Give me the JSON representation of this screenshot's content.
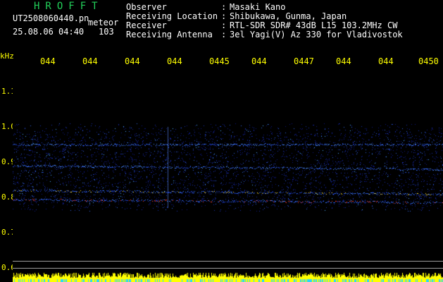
{
  "app": {
    "title": "HROFFT",
    "file_name": "UT2508060440.pn",
    "event_tag": "meteor",
    "date_time": "25.08.06 04:40",
    "count": "103"
  },
  "info": [
    {
      "label": "Observer",
      "value": "Masaki Kano"
    },
    {
      "label": "Receiving Location",
      "value": "Shibukawa, Gunma, Japan"
    },
    {
      "label": "Receiver",
      "value": "RTL-SDR SDR# 43dB L15 103.2MHz CW"
    },
    {
      "label": "Receiving Antenna",
      "value": "3el Yagi(V) Az 330 for Vladivostok"
    }
  ],
  "axis": {
    "unit": "kHz",
    "time_ticks": [
      "044",
      "044",
      "044",
      "044",
      "0445",
      "044",
      "0447",
      "044",
      "044",
      "0450"
    ],
    "freq_ticks": [
      "1.1",
      "1.0",
      "0.9",
      "0.8",
      "0.7",
      "0.6"
    ]
  },
  "colors": {
    "title": "#22d05a",
    "axis_labels": "#ffff00",
    "text": "#ffffff",
    "background": "#000000",
    "spectrogram_low": "#0a1a8c",
    "spectrogram_high": "#ff2020",
    "level_strip": "#ffff00"
  }
}
